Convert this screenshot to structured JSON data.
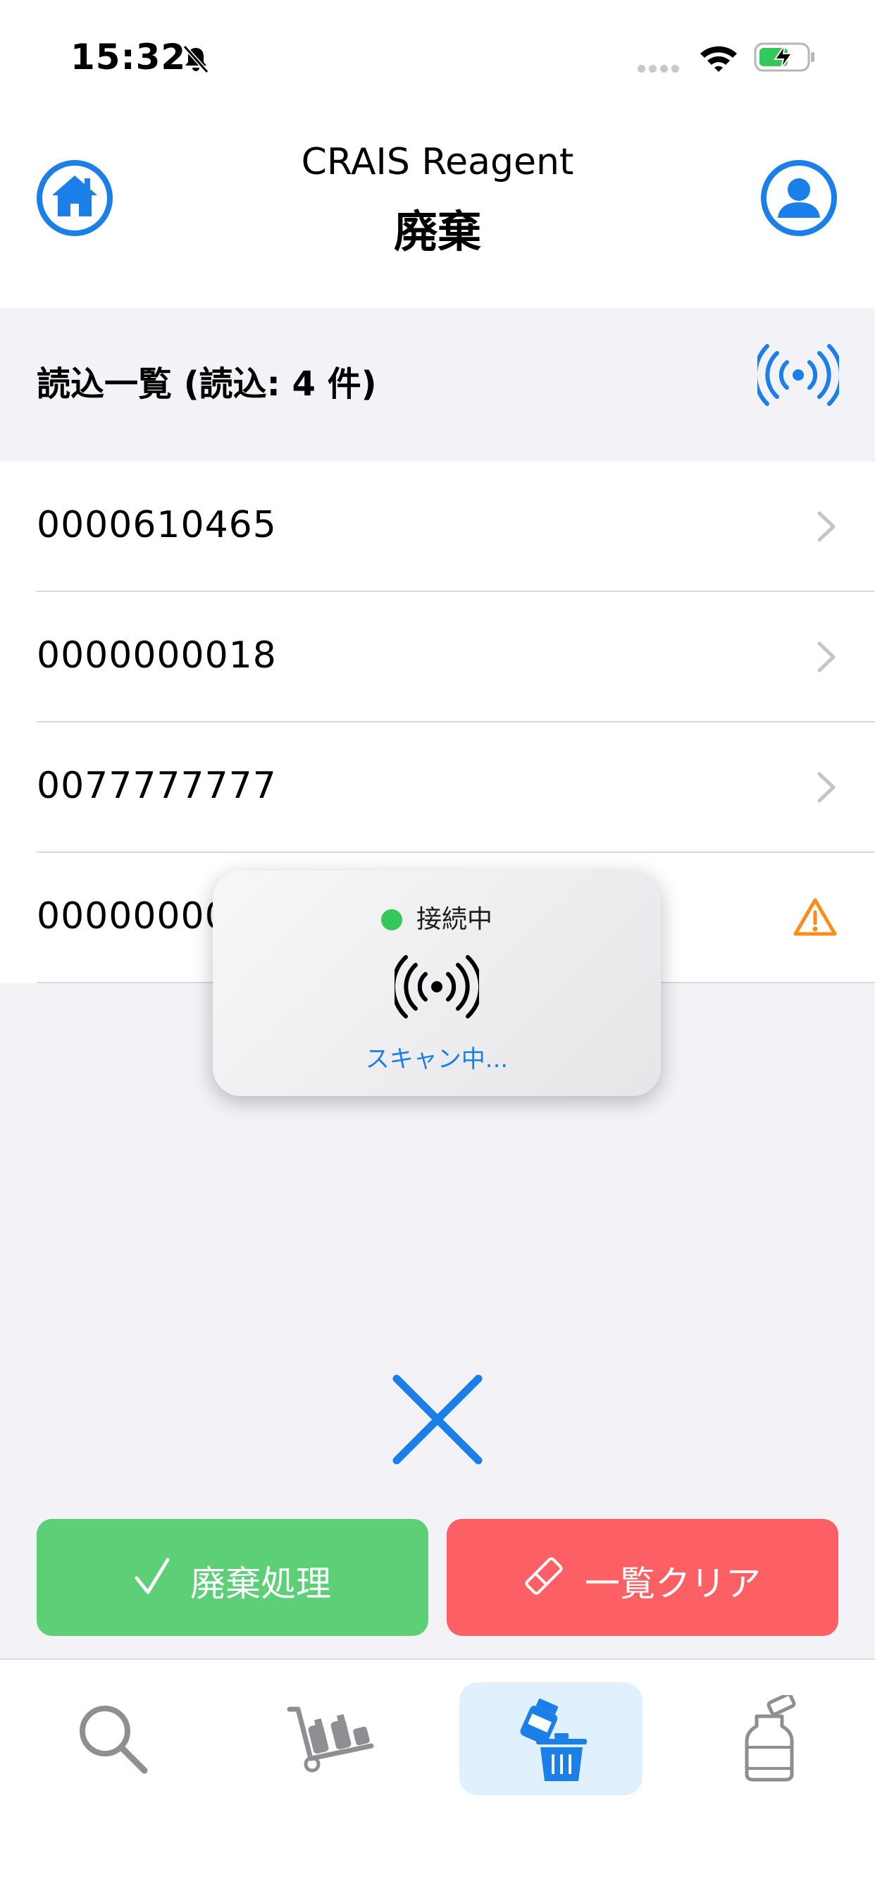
{
  "status_bar": {
    "time": "15:32"
  },
  "nav": {
    "app_name": "CRAIS Reagent",
    "title": "廃棄"
  },
  "section": {
    "title": "読込一覧 (読込: 4 件)"
  },
  "list": {
    "items": [
      {
        "code": "0000610465",
        "indicator": "chevron-right-icon"
      },
      {
        "code": "0000000018",
        "indicator": "chevron-right-icon"
      },
      {
        "code": "0077777777",
        "indicator": "chevron-right-icon"
      },
      {
        "code": "00000000",
        "indicator": "warning-icon"
      }
    ]
  },
  "popup": {
    "status": "接続中",
    "scanning": "スキャン中..."
  },
  "buttons": {
    "dispose_label": "廃棄処理",
    "clear_label": "一覧クリア"
  },
  "tabs": [
    {
      "icon": "search-icon",
      "selected": false
    },
    {
      "icon": "hand-truck-icon",
      "selected": false
    },
    {
      "icon": "dispose-bottle-icon",
      "selected": true
    },
    {
      "icon": "reagent-bottle-icon",
      "selected": false
    }
  ],
  "colors": {
    "accent": "#1a7fe8",
    "dispose_button": "#5ccf77",
    "clear_button": "#fc6064",
    "warning": "#ff8c1a",
    "connected": "#34c759",
    "selected_tab_bg": "#e1f0fd"
  }
}
